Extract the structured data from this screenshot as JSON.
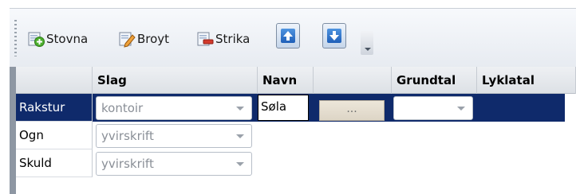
{
  "toolbar": {
    "buttons": [
      {
        "label": "Stovna",
        "icon": "add-icon"
      },
      {
        "label": "Broyt",
        "icon": "edit-icon"
      },
      {
        "label": "Strika",
        "icon": "delete-icon"
      }
    ],
    "move_up_icon": "arrow-up-icon",
    "move_down_icon": "arrow-down-icon"
  },
  "grid": {
    "columns": [
      "",
      "Slag",
      "Navn",
      "",
      "Grundtal",
      "Lyklatal"
    ],
    "rows": [
      {
        "label": "Rakstur",
        "slag": "kontoir",
        "navn": "Søla",
        "ellipsis": "...",
        "grundtal": "",
        "selected": true
      },
      {
        "label": "Ogn",
        "slag": "yvirskrift",
        "selected": false
      },
      {
        "label": "Skuld",
        "slag": "yvirskrift",
        "selected": false
      }
    ]
  },
  "colors": {
    "selection": "#0f2a6b",
    "header_bg": "#e6e9ed"
  }
}
